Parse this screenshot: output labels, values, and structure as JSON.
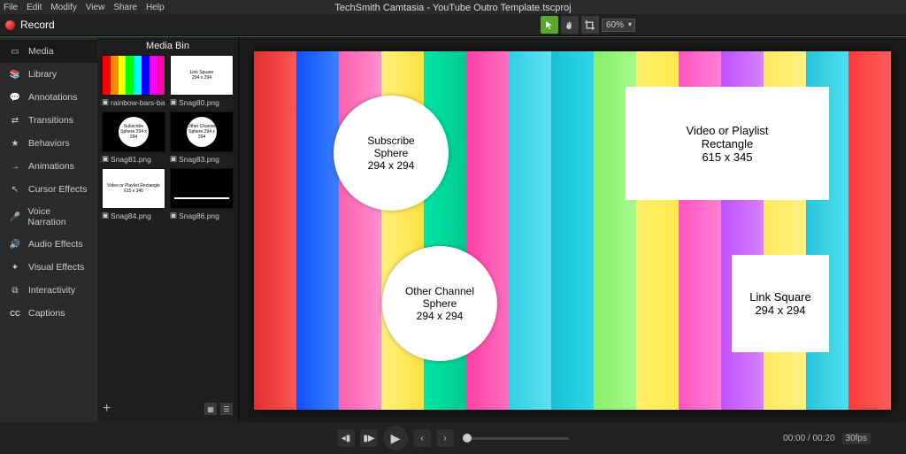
{
  "menu": {
    "file": "File",
    "edit": "Edit",
    "modify": "Modify",
    "view": "View",
    "share": "Share",
    "help": "Help"
  },
  "title": "TechSmith Camtasia - YouTube Outro Template.tscproj",
  "record": "Record",
  "toolbar": {
    "zoom": "60%"
  },
  "side": {
    "media": "Media",
    "library": "Library",
    "annotations": "Annotations",
    "transitions": "Transitions",
    "behaviors": "Behaviors",
    "animations": "Animations",
    "cursor": "Cursor Effects",
    "voice": "Voice Narration",
    "audio": "Audio Effects",
    "visual": "Visual Effects",
    "interactivity": "Interactivity",
    "captions": "Captions"
  },
  "bin": {
    "title": "Media Bin",
    "items": [
      {
        "name": "rainbow-bars-ba..."
      },
      {
        "name": "Snag80.png",
        "thumb": "Link Square\n294 x 294"
      },
      {
        "name": "Snag81.png",
        "thumb": "Subscribe Sphere\n294 x 294"
      },
      {
        "name": "Snag83.png",
        "thumb": "Other Channel Sphere\n294 x 294"
      },
      {
        "name": "Snag84.png",
        "thumb": "Video or Playlist Rectangle\n615 x 345"
      },
      {
        "name": "Snag86.png"
      }
    ]
  },
  "canvas": {
    "subscribe": {
      "l1": "Subscribe",
      "l2": "Sphere",
      "l3": "294 x 294"
    },
    "other": {
      "l1": "Other Channel",
      "l2": "Sphere",
      "l3": "294 x 294"
    },
    "video": {
      "l1": "Video or Playlist",
      "l2": "Rectangle",
      "l3": "615 x 345"
    },
    "link": {
      "l1": "Link Square",
      "l2": "294 x 294"
    }
  },
  "playback": {
    "time": "00:00 / 00:20",
    "fps": "30fps"
  }
}
